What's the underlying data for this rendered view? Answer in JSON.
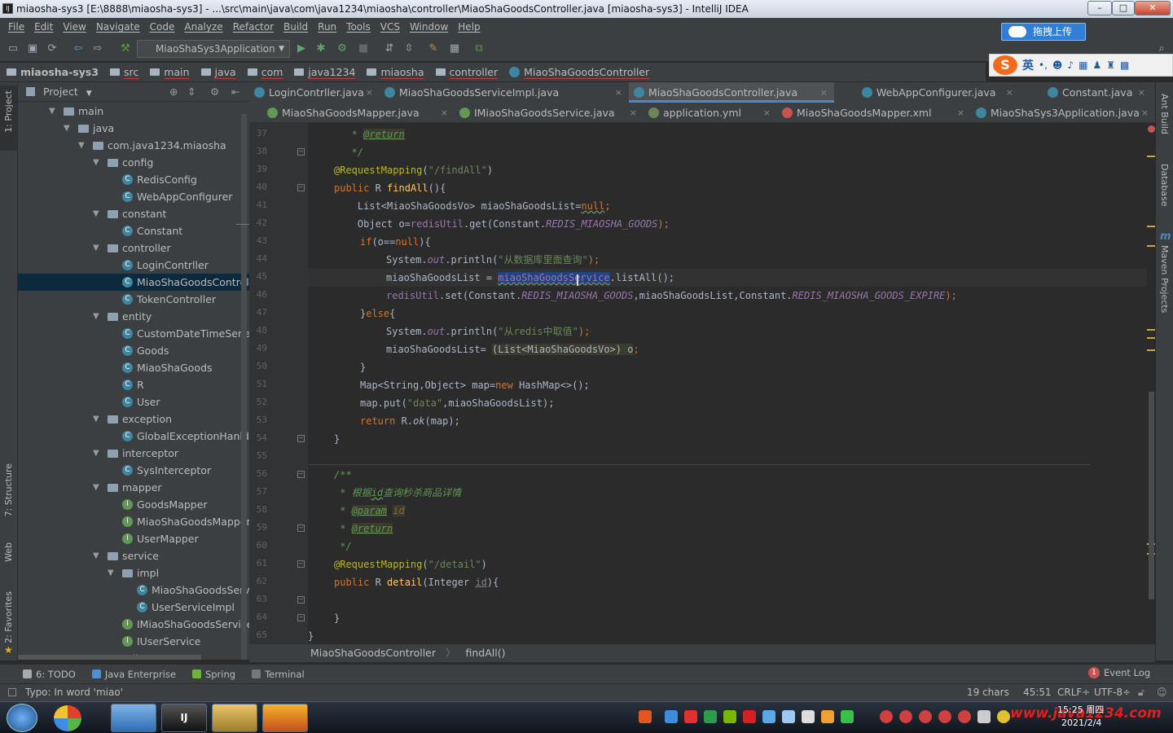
{
  "window": {
    "title": "miaosha-sys3 [E:\\8888\\miaosha-sys3] - ...\\src\\main\\java\\com\\java1234\\miaosha\\controller\\MiaoShaGoodsController.java [miaosha-sys3] - IntelliJ IDEA",
    "app_icon": "IJ",
    "minimize": "–",
    "maximize": "□",
    "close": "✕"
  },
  "menu": [
    "File",
    "Edit",
    "View",
    "Navigate",
    "Code",
    "Analyze",
    "Refactor",
    "Build",
    "Run",
    "Tools",
    "VCS",
    "Window",
    "Help"
  ],
  "toolbar": {
    "run_config": "MiaoShaSys3Application",
    "upload_label": "拖拽上传",
    "ime_mode": "英"
  },
  "breadcrumb": [
    "miaosha-sys3",
    "src",
    "main",
    "java",
    "com",
    "java1234",
    "miaosha",
    "controller",
    "MiaoShaGoodsController"
  ],
  "project_panel": {
    "title": "Project",
    "side_tab": "1: Project",
    "tree": [
      {
        "label": "main",
        "depth": 0,
        "kind": "folder",
        "open": true
      },
      {
        "label": "java",
        "depth": 1,
        "kind": "folder",
        "open": true
      },
      {
        "label": "com.java1234.miaosha",
        "depth": 2,
        "kind": "folder",
        "open": true
      },
      {
        "label": "config",
        "depth": 3,
        "kind": "folder",
        "open": true
      },
      {
        "label": "RedisConfig",
        "depth": 4,
        "kind": "class"
      },
      {
        "label": "WebAppConfigurer",
        "depth": 4,
        "kind": "class"
      },
      {
        "label": "constant",
        "depth": 3,
        "kind": "folder",
        "open": true
      },
      {
        "label": "Constant",
        "depth": 4,
        "kind": "class"
      },
      {
        "label": "controller",
        "depth": 3,
        "kind": "folder",
        "open": true
      },
      {
        "label": "LoginContrller",
        "depth": 4,
        "kind": "class"
      },
      {
        "label": "MiaoShaGoodsControll",
        "depth": 4,
        "kind": "class",
        "selected": true
      },
      {
        "label": "TokenController",
        "depth": 4,
        "kind": "class"
      },
      {
        "label": "entity",
        "depth": 3,
        "kind": "folder",
        "open": true
      },
      {
        "label": "CustomDateTimeSeriali",
        "depth": 4,
        "kind": "class"
      },
      {
        "label": "Goods",
        "depth": 4,
        "kind": "class"
      },
      {
        "label": "MiaoShaGoods",
        "depth": 4,
        "kind": "class"
      },
      {
        "label": "R",
        "depth": 4,
        "kind": "class"
      },
      {
        "label": "User",
        "depth": 4,
        "kind": "class"
      },
      {
        "label": "exception",
        "depth": 3,
        "kind": "folder",
        "open": true
      },
      {
        "label": "GlobalExceptionHanlde",
        "depth": 4,
        "kind": "class"
      },
      {
        "label": "interceptor",
        "depth": 3,
        "kind": "folder",
        "open": true
      },
      {
        "label": "SysInterceptor",
        "depth": 4,
        "kind": "class"
      },
      {
        "label": "mapper",
        "depth": 3,
        "kind": "folder",
        "open": true
      },
      {
        "label": "GoodsMapper",
        "depth": 4,
        "kind": "interface"
      },
      {
        "label": "MiaoShaGoodsMapper",
        "depth": 4,
        "kind": "interface"
      },
      {
        "label": "UserMapper",
        "depth": 4,
        "kind": "interface"
      },
      {
        "label": "service",
        "depth": 3,
        "kind": "folder",
        "open": true
      },
      {
        "label": "impl",
        "depth": 4,
        "kind": "folder",
        "open": true
      },
      {
        "label": "MiaoShaGoodsServi",
        "depth": 5,
        "kind": "class"
      },
      {
        "label": "UserServiceImpl",
        "depth": 5,
        "kind": "class"
      },
      {
        "label": "IMiaoShaGoodsService",
        "depth": 4,
        "kind": "interface"
      },
      {
        "label": "IUserService",
        "depth": 4,
        "kind": "interface"
      },
      {
        "label": "util",
        "depth": 3,
        "kind": "folder",
        "open": true
      }
    ]
  },
  "left_side_tabs": [
    "7: Structure",
    "Web",
    "2: Favorites"
  ],
  "right_side_tabs": [
    "Ant Build",
    "Database",
    "Maven Projects"
  ],
  "tabs_row1": [
    {
      "label": "LoginContrller.java"
    },
    {
      "label": "MiaoShaGoodsServiceImpl.java"
    },
    {
      "label": "MiaoShaGoodsController.java",
      "active": true
    },
    {
      "label": "WebAppConfigurer.java"
    },
    {
      "label": "Constant.java"
    }
  ],
  "tabs_row2": [
    {
      "label": "MiaoShaGoodsMapper.java"
    },
    {
      "label": "IMiaoShaGoodsService.java"
    },
    {
      "label": "application.yml"
    },
    {
      "label": "MiaoShaGoodsMapper.xml"
    },
    {
      "label": "MiaoShaSys3Application.java"
    }
  ],
  "line_numbers": [
    "37",
    "38",
    "39",
    "40",
    "41",
    "42",
    "43",
    "44",
    "45",
    "46",
    "47",
    "48",
    "49",
    "50",
    "51",
    "52",
    "53",
    "54",
    "55",
    "56",
    "57",
    "58",
    "59",
    "60",
    "61",
    "62",
    "63",
    "64",
    "65"
  ],
  "code": {
    "l37_a": "   * ",
    "l37_tag": "@return",
    "l38": "   */",
    "l39_ann": "@RequestMapping",
    "l39_b": "(",
    "l39_str": "\"/findAll\"",
    "l39_c": ")",
    "l40_kw": "public",
    "l40_b": " R ",
    "l40_fn": "findAll",
    "l40_c": "(){",
    "l41_a": "    List<MiaoShaGoodsVo> miaoShaGoodsList=",
    "l41_kw": "null",
    "l41_b": ";",
    "l42_a": "    Object o=",
    "l42_v": "redisUtil",
    "l42_b": ".get(Constant.",
    "l42_it": "REDIS_MIAOSHA_GOODS",
    "l42_c": ");",
    "l43_kw": "if",
    "l43_b": "(o==",
    "l43_kw2": "null",
    "l43_c": "){",
    "l44_a": "System.",
    "l44_it": "out",
    "l44_b": ".println(",
    "l44_str": "\"从数据库里面查询\"",
    "l44_c": ");",
    "l45_a": "miaoShaGoodsList = ",
    "l45_sel": "miaoShaGoodsService",
    "l45_b": ".listAll();",
    "l46_v": "redisUtil",
    "l46_a": ".set(Constant.",
    "l46_it": "REDIS_MIAOSHA_GOODS",
    "l46_b": ",miaoShaGoodsList,Constant.",
    "l46_it2": "REDIS_MIAOSHA_GOODS_EXPIRE",
    "l46_c": ");",
    "l47_a": "}",
    "l47_kw": "else",
    "l47_b": "{",
    "l48_a": "System.",
    "l48_it": "out",
    "l48_b": ".println(",
    "l48_str": "\"从redis中取值\"",
    "l48_c": ");",
    "l49_a": "miaoShaGoodsList= ",
    "l49_cast": "(List<MiaoShaGoodsVo>) o",
    "l49_b": ";",
    "l50": "}",
    "l51_a": "Map<String,Object> map=",
    "l51_kw": "new",
    "l51_b": " HashMap<>();",
    "l52_a": "map.put(",
    "l52_str": "\"data\"",
    "l52_b": ",miaoShaGoodsList);",
    "l53_kw": "return",
    "l53_a": " R.",
    "l53_it": "ok",
    "l53_b": "(map);",
    "l54": "}",
    "l56": "/**",
    "l57_a": " * 根据",
    "l57_id": "id",
    "l57_b": "查询秒杀商品详情",
    "l58_a": " * ",
    "l58_tag": "@param",
    "l58_p": "id",
    "l59_a": " * ",
    "l59_tag": "@return",
    "l60": " */",
    "l61_ann": "@RequestMapping",
    "l61_b": "(",
    "l61_str": "\"/detail\"",
    "l61_c": ")",
    "l62_kw": "public",
    "l62_b": " R ",
    "l62_fn": "detail",
    "l62_c": "(Integer ",
    "l62_p": "id",
    "l62_d": "){",
    "l64": "}",
    "l65": "}"
  },
  "nav_crumb": {
    "cls": "MiaoShaGoodsController",
    "sep": "〉",
    "method": "findAll()"
  },
  "bottom_tools": [
    {
      "label": "6: TODO",
      "color": "#a9a9a9"
    },
    {
      "label": "Java Enterprise",
      "color": "#4f8fd3"
    },
    {
      "label": "Spring",
      "color": "#6db33f"
    },
    {
      "label": "Terminal",
      "color": "#777777"
    }
  ],
  "event_log": {
    "badge": "1",
    "label": "Event Log"
  },
  "status": {
    "message": "Typo: In word 'miao'",
    "chars": "19 chars",
    "position": "45:51",
    "line_sep": "CRLF÷",
    "encoding": "UTF-8÷"
  },
  "taskbar": {
    "time": "15:25 周四",
    "date": "2021/2/4",
    "watermark": "www.java1234.com"
  }
}
